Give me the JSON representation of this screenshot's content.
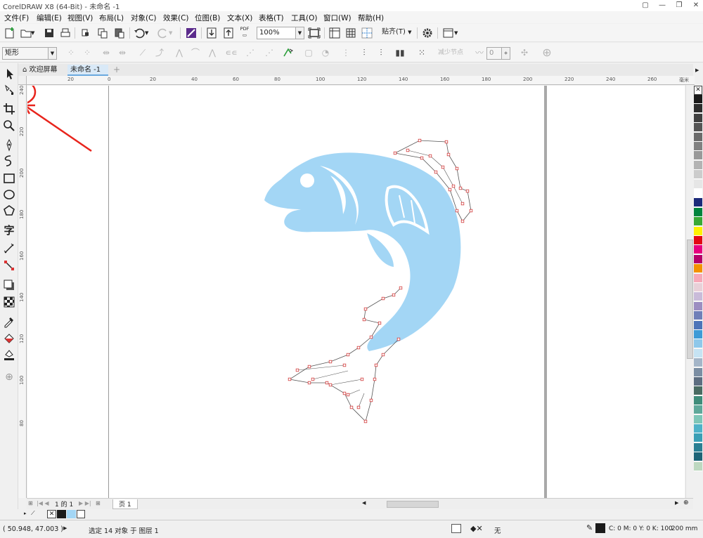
{
  "window": {
    "title": "CorelDRAW X8 (64-Bit) - 未命名 -1"
  },
  "menu": [
    "文件(F)",
    "编辑(E)",
    "视图(V)",
    "布局(L)",
    "对象(C)",
    "效果(C)",
    "位图(B)",
    "文本(X)",
    "表格(T)",
    "工具(O)",
    "窗口(W)",
    "帮助(H)"
  ],
  "toolbar": {
    "zoom": "100%",
    "snap": "贴齐(T)",
    "pdf_label": "PDF"
  },
  "propbar": {
    "shape_type": "矩形",
    "node_reduce": "减少节点",
    "smoothness": "0"
  },
  "tabs": {
    "welcome": "欢迎屏幕",
    "document": "未命名 -1",
    "add": "+"
  },
  "hruler": {
    "labels": [
      "20",
      "0",
      "20",
      "40",
      "60",
      "80",
      "100",
      "120",
      "140",
      "160",
      "180",
      "200",
      "220",
      "240",
      "260"
    ],
    "unit": "毫米"
  },
  "vruler": {
    "labels": [
      "240",
      "220",
      "200",
      "180",
      "160",
      "140",
      "120",
      "100",
      "80"
    ]
  },
  "pages": {
    "current": "1",
    "of": "的",
    "total": "1",
    "page_tab": "页 1"
  },
  "statusbar": {
    "coords": "( 50.948, 47.003 )",
    "selection": "选定 14 对象 于 图层 1",
    "fill": "无",
    "outline_color": "C: 0 M: 0 Y: 0 K: 100",
    "outline_width": ".200 mm"
  },
  "colors": {
    "fish": "#a3d6f5",
    "nodes": "#d33b3b",
    "annotation": "#e8241c",
    "palette": [
      "#1a1a1a",
      "#2d2d2d",
      "#404040",
      "#555555",
      "#6b6b6b",
      "#808080",
      "#999999",
      "#b3b3b3",
      "#cccccc",
      "#e6e6e6",
      "#ffffff",
      "#1c2b7a",
      "#00843d",
      "#3aa935",
      "#fff000",
      "#e30613",
      "#e6007e",
      "#b5006a",
      "#f39200",
      "#f6a8b8",
      "#e8d0d8",
      "#c9bbd9",
      "#9c8ec1",
      "#6f7fb8",
      "#4d74b8",
      "#3f9bd6",
      "#8fc8ea",
      "#c6e3f3",
      "#a4b5c8",
      "#7b8ea3",
      "#5d6d80",
      "#4a6b62",
      "#3f8c7a",
      "#5fa89a",
      "#7fc6b8",
      "#4fb2c8",
      "#3a9fb5",
      "#2a7f93",
      "#1d6477",
      "#bdd8c0"
    ],
    "doc_fill": "#a3d6f5",
    "doc_outline": "#1a1a1a"
  }
}
